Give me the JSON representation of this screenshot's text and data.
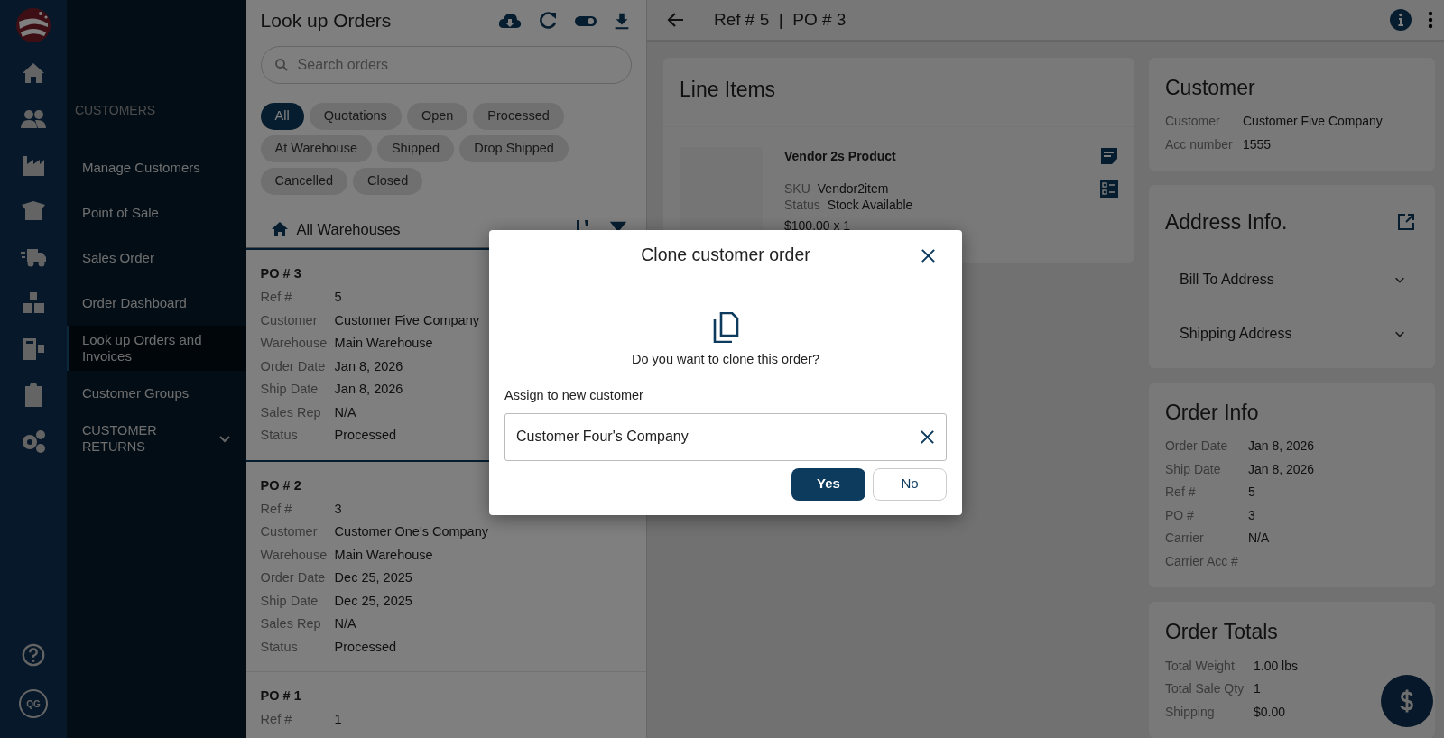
{
  "rail": {
    "avatar": "QG"
  },
  "sidebar": {
    "section": "CUSTOMERS",
    "items": [
      {
        "label": "Manage Customers",
        "kind": "link",
        "selected": false
      },
      {
        "label": "Point of Sale",
        "kind": "link",
        "selected": false
      },
      {
        "label": "Sales Order",
        "kind": "link",
        "selected": false
      },
      {
        "label": "Order Dashboard",
        "kind": "link",
        "selected": false
      },
      {
        "label": "Look up Orders and Invoices",
        "kind": "link",
        "selected": true
      },
      {
        "label": "Customer Groups",
        "kind": "link",
        "selected": false
      },
      {
        "label": "CUSTOMER RETURNS",
        "kind": "group",
        "expanded": false
      }
    ]
  },
  "orders_panel": {
    "title": "Look up Orders",
    "search": {
      "placeholder": "Search orders"
    },
    "filters": [
      {
        "label": "All",
        "selected": true
      },
      {
        "label": "Quotations",
        "selected": false
      },
      {
        "label": "Open",
        "selected": false
      },
      {
        "label": "Processed",
        "selected": false
      },
      {
        "label": "At Warehouse",
        "selected": false
      },
      {
        "label": "Shipped",
        "selected": false
      },
      {
        "label": "Drop Shipped",
        "selected": false
      },
      {
        "label": "Cancelled",
        "selected": false
      },
      {
        "label": "Closed",
        "selected": false
      }
    ],
    "warehouse": "All Warehouses",
    "orders": [
      {
        "title": "PO # 3",
        "selected": true,
        "fields": [
          {
            "label": "Ref #",
            "value": "5"
          },
          {
            "label": "Customer",
            "value": "Customer Five Company"
          },
          {
            "label": "Warehouse",
            "value": "Main Warehouse"
          },
          {
            "label": "Order Date",
            "value": "Jan 8, 2026"
          },
          {
            "label": "Ship Date",
            "value": "Jan 8, 2026"
          },
          {
            "label": "Sales Rep",
            "value": "N/A"
          },
          {
            "label": "Status",
            "value": "Processed"
          }
        ]
      },
      {
        "title": "PO # 2",
        "selected": false,
        "fields": [
          {
            "label": "Ref #",
            "value": "3"
          },
          {
            "label": "Customer",
            "value": "Customer One's Company"
          },
          {
            "label": "Warehouse",
            "value": "Main Warehouse"
          },
          {
            "label": "Order Date",
            "value": "Dec 25, 2025"
          },
          {
            "label": "Ship Date",
            "value": "Dec 25, 2025"
          },
          {
            "label": "Sales Rep",
            "value": "N/A"
          },
          {
            "label": "Status",
            "value": "Processed"
          }
        ]
      },
      {
        "title": "PO # 1",
        "selected": false,
        "fields": [
          {
            "label": "Ref #",
            "value": "1"
          }
        ]
      }
    ]
  },
  "detail": {
    "header": "Ref # 5  |  PO # 3",
    "line_items": {
      "title": "Line Items",
      "items": [
        {
          "name": "Vendor 2s Product",
          "fields": [
            {
              "label": "SKU",
              "value": "Vendor2item"
            },
            {
              "label": "Status",
              "value": "Stock Available"
            }
          ],
          "price": "$100.00 x 1"
        }
      ]
    },
    "customer": {
      "title": "Customer",
      "fields": [
        {
          "label": "Customer",
          "value": "Customer Five Company"
        },
        {
          "label": "Acc number",
          "value": "1555"
        }
      ]
    },
    "address": {
      "title": "Address Info.",
      "sections": [
        {
          "label": "Bill To Address",
          "expanded": false
        },
        {
          "label": "Shipping Address",
          "expanded": false
        }
      ]
    },
    "order_info": {
      "title": "Order Info",
      "fields": [
        {
          "label": "Order Date",
          "value": "Jan 8, 2026"
        },
        {
          "label": "Ship Date",
          "value": "Jan 8, 2026"
        },
        {
          "label": "Ref #",
          "value": "5"
        },
        {
          "label": "PO #",
          "value": "3"
        },
        {
          "label": "Carrier",
          "value": "N/A"
        },
        {
          "label": "Carrier Acc #"
        }
      ]
    },
    "order_totals": {
      "title": "Order Totals",
      "fields": [
        {
          "label": "Total Weight",
          "value": "1.00 lbs"
        },
        {
          "label": "Total Sale Qty",
          "value": "1"
        },
        {
          "label": "Shipping",
          "value": "$0.00"
        }
      ]
    }
  },
  "dialog": {
    "title": "Clone customer order",
    "question": "Do you want to clone this order?",
    "field_label": "Assign to new customer",
    "field_value": "Customer Four's Company",
    "buttons": [
      {
        "label": "Yes",
        "kind": "primary"
      },
      {
        "label": "No",
        "kind": "secondary"
      }
    ]
  }
}
